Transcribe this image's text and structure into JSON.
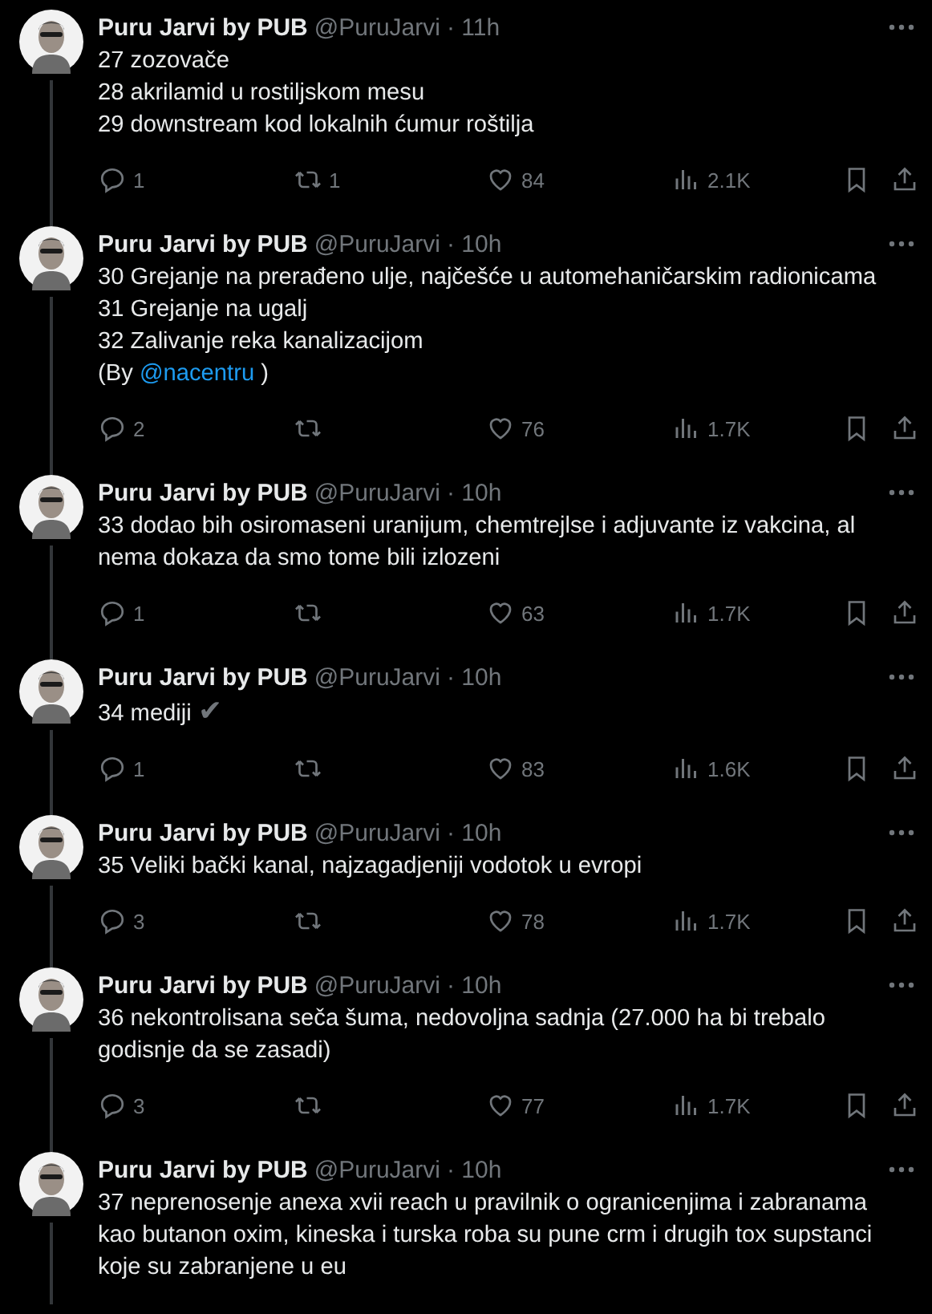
{
  "tweets": [
    {
      "name": "Puru Jarvi by PUB",
      "handle": "@PuruJarvi",
      "time": "· 11h",
      "lines": [
        [
          {
            "kind": "text",
            "text": "27 zozovače"
          }
        ],
        [
          {
            "kind": "text",
            "text": "28 akrilamid u rostiljskom mesu"
          }
        ],
        [
          {
            "kind": "text",
            "text": "29 downstream kod lokalnih ćumur roštilja"
          }
        ]
      ],
      "replies": "1",
      "reposts": "1",
      "likes": "84",
      "views": "2.1K"
    },
    {
      "name": "Puru Jarvi by PUB",
      "handle": "@PuruJarvi",
      "time": "· 10h",
      "lines": [
        [
          {
            "kind": "text",
            "text": "30 Grejanje na prerađeno ulje, najčešće u automehaničarskim radionicama"
          }
        ],
        [
          {
            "kind": "text",
            "text": "31 Grejanje na ugalj"
          }
        ],
        [
          {
            "kind": "text",
            "text": "32 Zalivanje reka kanalizacijom"
          }
        ],
        [
          {
            "kind": "text",
            "text": "(By "
          },
          {
            "kind": "link",
            "text": "@nacentru"
          },
          {
            "kind": "text",
            "text": " )"
          }
        ]
      ],
      "replies": "2",
      "likes": "76",
      "views": "1.7K"
    },
    {
      "name": "Puru Jarvi by PUB",
      "handle": "@PuruJarvi",
      "time": "· 10h",
      "lines": [
        [
          {
            "kind": "text",
            "text": "33 dodao bih osiromaseni uranijum, chemtrejlse i adjuvante iz vakcina, al"
          }
        ],
        [
          {
            "kind": "text",
            "text": "nema dokaza da smo tome bili izlozeni"
          }
        ]
      ],
      "replies": "1",
      "likes": "63",
      "views": "1.7K"
    },
    {
      "name": "Puru Jarvi by PUB",
      "handle": "@PuruJarvi",
      "time": "· 10h",
      "lines": [
        [
          {
            "kind": "text",
            "text": "34 mediji "
          },
          {
            "kind": "emoji",
            "text": "✔"
          }
        ]
      ],
      "replies": "1",
      "likes": "83",
      "views": "1.6K"
    },
    {
      "name": "Puru Jarvi by PUB",
      "handle": "@PuruJarvi",
      "time": "· 10h",
      "lines": [
        [
          {
            "kind": "text",
            "text": "35 Veliki bački kanal, najzagadjeniji vodotok u evropi"
          }
        ]
      ],
      "replies": "3",
      "likes": "78",
      "views": "1.7K"
    },
    {
      "name": "Puru Jarvi by PUB",
      "handle": "@PuruJarvi",
      "time": "· 10h",
      "lines": [
        [
          {
            "kind": "text",
            "text": "36 nekontrolisana seča šuma, nedovoljna sadnja (27.000 ha bi trebalo"
          }
        ],
        [
          {
            "kind": "text",
            "text": "godisnje da se zasadi)"
          }
        ]
      ],
      "replies": "3",
      "likes": "77",
      "views": "1.7K"
    },
    {
      "name": "Puru Jarvi by PUB",
      "handle": "@PuruJarvi",
      "time": "· 10h",
      "lines": [
        [
          {
            "kind": "text",
            "text": "37 neprenosenje anexa xvii reach u pravilnik o ogranicenjima i zabranama"
          }
        ],
        [
          {
            "kind": "text",
            "text": "kao butanon oxim, kineska i turska roba su pune crm i drugih tox supstanci"
          }
        ],
        [
          {
            "kind": "text",
            "text": "koje su zabranjene u eu"
          }
        ]
      ]
    }
  ]
}
